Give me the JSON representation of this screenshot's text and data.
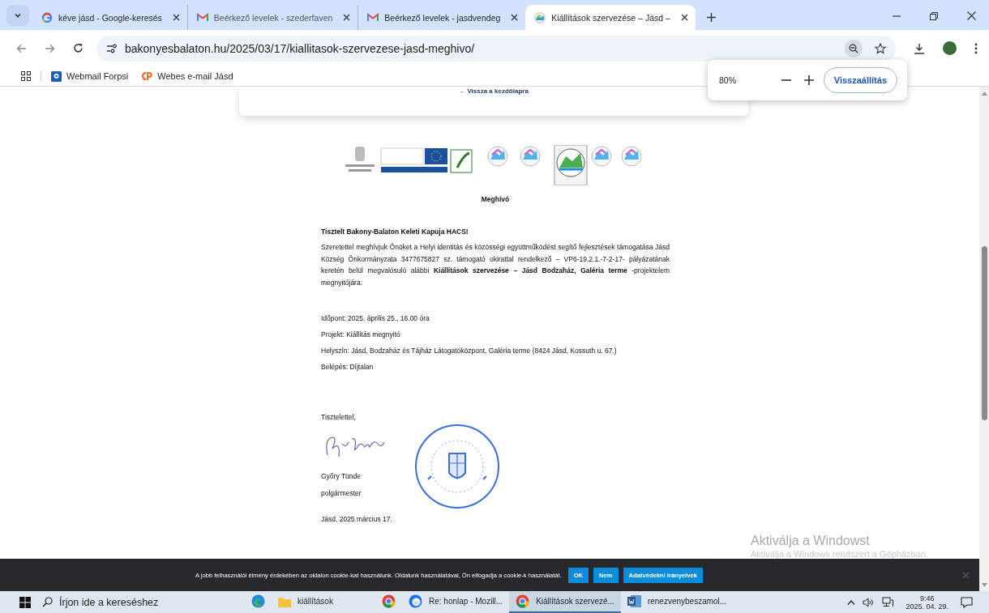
{
  "browser": {
    "tabs": [
      {
        "kind": "google",
        "label": "kéve jásd - Google-keresés",
        "selected": false
      },
      {
        "kind": "gmail",
        "label": "Beérkező levelek - szederfaven",
        "selected": false
      },
      {
        "kind": "gmail",
        "label": "Beérkező levelek - jasdvendeg",
        "selected": false
      },
      {
        "kind": "site",
        "label": "Kiállítások szervezése – Jásd –",
        "selected": true
      }
    ],
    "url": "bakonyesbalaton.hu/2025/03/17/kiallitasok-szervezese-jasd-meghivo/",
    "bookmarks": [
      {
        "kind": "forpsi",
        "label": "Webmail Forpsi"
      },
      {
        "kind": "cpanel",
        "label": "Webes e-mail Jásd"
      }
    ],
    "zoom_popup": {
      "value": "80%",
      "reset": "Visszaállítás"
    }
  },
  "page": {
    "back_link": "← Vissza a kezdőlapra",
    "title": "Meghívó",
    "salutation": "Tisztelt Bakony-Balaton Keleti Kapuja HACS!",
    "body": "Szeretettel meghívjuk Önöket a Helyi identitás és közösségi együttműködést segítő fejlesztések támogatása Jásd Község Önkormányzata 3477675827 sz. támogató okirattal rendelkező – VP6-19.2.1.-7-2-17- pályázatának keretén belül megvalósuló alábbi **Kiállítások szervezése – Jásd Bodzaház, Galéria terme** -projektelem megnyitójára:",
    "details": [
      "Időpont: 2025. április 25., 16.00 óra",
      "Projekt:  Kiállítás megnyitó",
      "Helyszín: Jásd, Bodzaház és Tájház Látogatóközpont, Galéria terme (8424 Jásd, Kossuth u. 67.)",
      "Belépés: Díjtalan"
    ],
    "closing": "Tisztelettel,",
    "signer_name": "Győry Tünde",
    "signer_role": "polgármester",
    "place_date": "Jásd, 2025 március 17."
  },
  "windows_activation": {
    "title": "Aktiválja a Windowst",
    "subtitle": "Aktiválja a Windows rendszert a Gépházban."
  },
  "cookie_banner": {
    "text": "A jobb felhasználói élmény érdekében az oldalon cookie-kat használunk. Oldalunk használatával, Ön elfogadja a cookie-k használatát.",
    "buttons": [
      "OK",
      "Nem",
      "Adatvédelmi irányelvek"
    ]
  },
  "taskbar": {
    "search_placeholder": "Írjon ide a kereséshez",
    "apps": [
      {
        "kind": "edge",
        "selected": false
      },
      {
        "kind": "folder",
        "label": "kiállítások",
        "selected": false
      },
      {
        "kind": "chrome",
        "selected": false
      },
      {
        "kind": "thunderbird",
        "label": "Re: honlap - Mozill...",
        "selected": false
      },
      {
        "kind": "chrome",
        "label": "Kiállítások szervezé...",
        "selected": true
      },
      {
        "kind": "word",
        "label": "renezvenybeszamol...",
        "selected": false
      }
    ],
    "time": "9:46",
    "date": "2025. 04. 29."
  }
}
